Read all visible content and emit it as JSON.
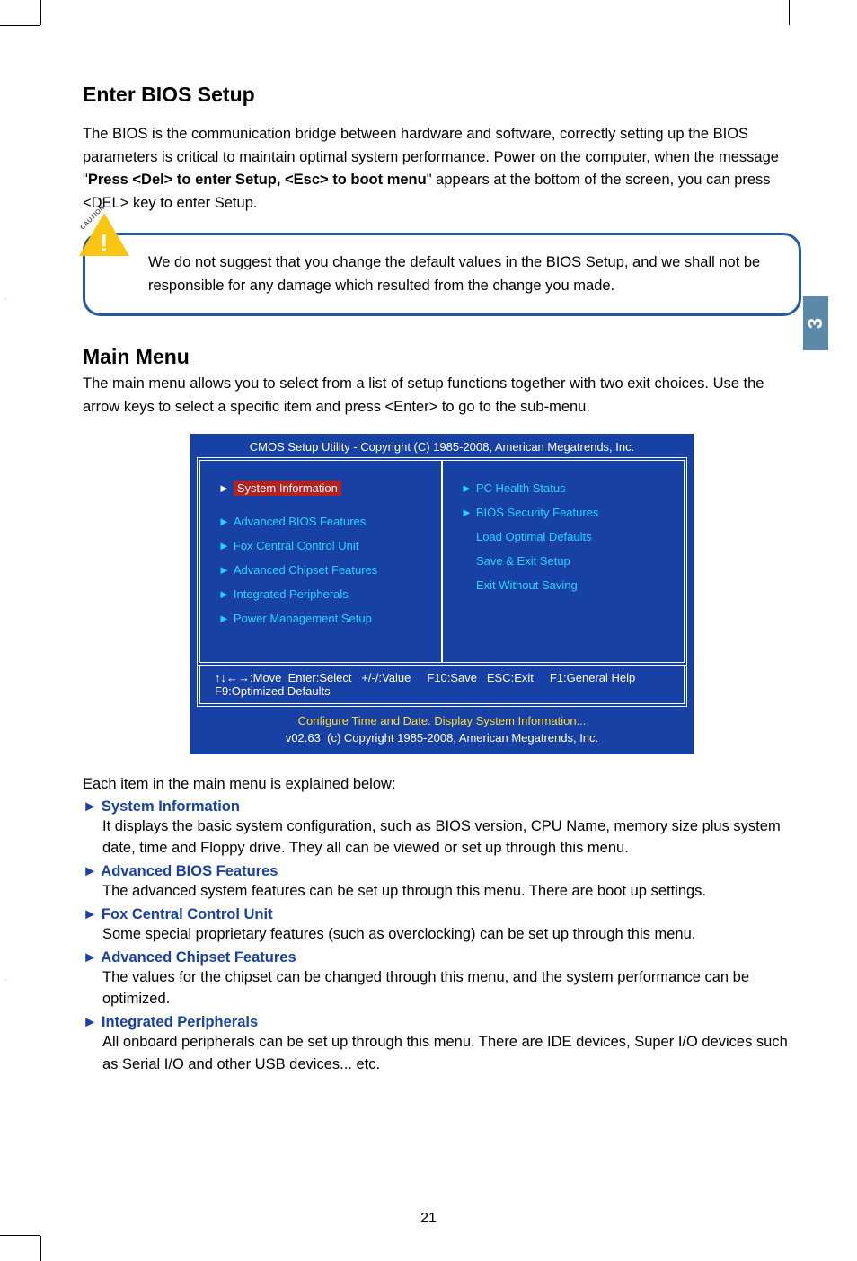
{
  "sideTab": "3",
  "title1": "Enter BIOS Setup",
  "para1a": "The BIOS is the communication bridge between hardware and software, correctly setting up the BIOS parameters is critical to maintain optimal system performance. Power on the computer, when the message \"",
  "para1bold": "Press <Del> to enter Setup, <Esc> to boot menu",
  "para1b": "\" appears at the bottom of the screen, you can press <DEL> key to enter Setup.",
  "cautionLabel": "CAUTION",
  "cautionMark": "!",
  "cautionText": "We do not suggest that you change the default values in the BIOS Setup, and we shall not be responsible for any damage which resulted from the change you made.",
  "title2": "Main Menu",
  "para2": "The main menu allows you to select from a list of setup functions together with two exit choices. Use the arrow keys to select a specific item and press <Enter> to go to the sub-menu.",
  "bios": {
    "header": "CMOS Setup Utility - Copyright (C) 1985-2008, American Megatrends, Inc.",
    "left": [
      {
        "arrow": "►",
        "label": "System Information",
        "selected": true
      },
      {
        "arrow": "►",
        "label": "Advanced BIOS Features"
      },
      {
        "arrow": "►",
        "label": "Fox Central Control Unit"
      },
      {
        "arrow": "►",
        "label": "Advanced Chipset Features"
      },
      {
        "arrow": "►",
        "label": "Integrated Peripherals"
      },
      {
        "arrow": "►",
        "label": "Power Management Setup"
      }
    ],
    "right": [
      {
        "arrow": "►",
        "label": "PC Health Status"
      },
      {
        "arrow": "►",
        "label": "BIOS Security Features"
      },
      {
        "arrow": "",
        "label": "Load Optimal Defaults"
      },
      {
        "arrow": "",
        "label": "Save & Exit Setup"
      },
      {
        "arrow": "",
        "label": "Exit Without Saving"
      }
    ],
    "hints": {
      "move": "↑↓←→:Move",
      "select": "Enter:Select",
      "value": "+/-/:Value",
      "save": "F10:Save",
      "exit": "ESC:Exit",
      "help": "F1:General Help",
      "defaults": "F9:Optimized Defaults"
    },
    "footer": "Configure Time and Date.  Display System Information...",
    "version": "v02.63",
    "copyright": "(c) Copyright 1985-2008, American Megatrends, Inc."
  },
  "explainIntro": "Each item in the main menu is explained below:",
  "items": [
    {
      "h": "► System Information",
      "b": "It displays the basic system configuration, such as BIOS version, CPU Name, memory size plus system date, time and Floppy drive. They all can be viewed or set up through this menu."
    },
    {
      "h": "► Advanced BIOS Features",
      "b": "The advanced system features can be set up through this menu. There are boot up settings."
    },
    {
      "h": "► Fox Central Control Unit",
      "b": "Some special proprietary features (such as overclocking) can be set up through this menu."
    },
    {
      "h": "► Advanced Chipset Features",
      "b": "The values for the chipset can be changed through this menu, and the system performance can be optimized."
    },
    {
      "h": "► Integrated Peripherals",
      "b": "All onboard peripherals can be set up through this menu. There are IDE devices, Super I/O devices such as Serial I/O and other USB devices... etc."
    }
  ],
  "pageNum": "21",
  "quoteLeft1": "\"",
  "quoteLeft2": "\""
}
